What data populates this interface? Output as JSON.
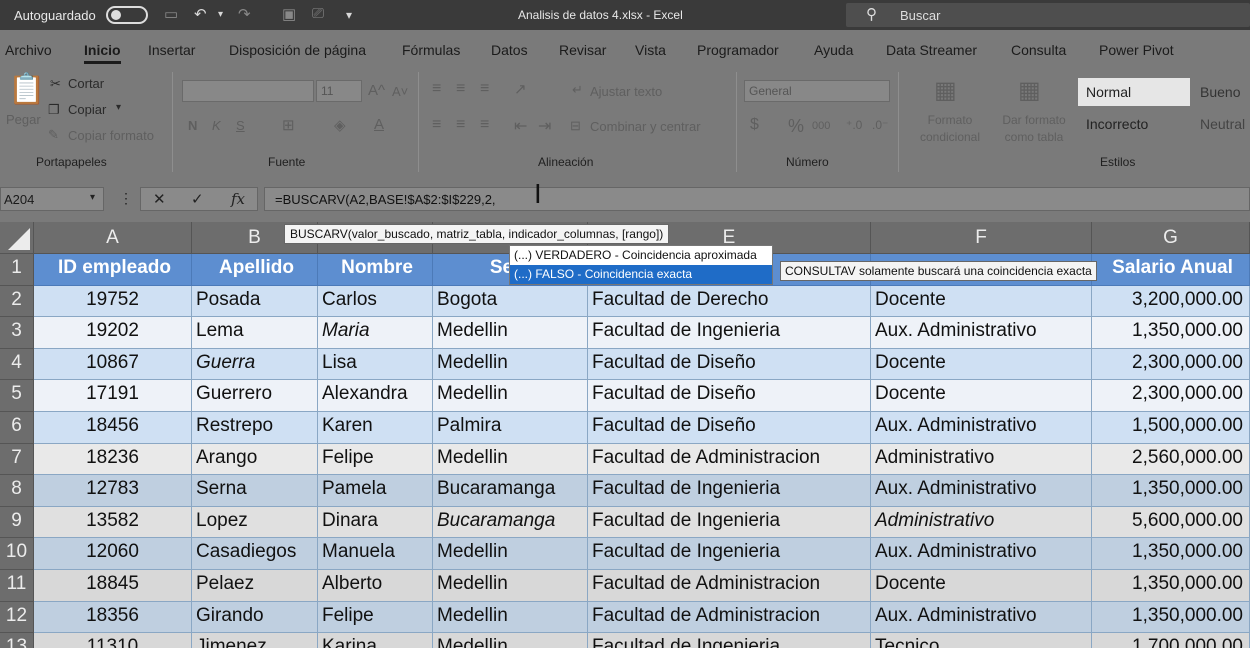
{
  "titlebar": {
    "autosave_label": "Autoguardado",
    "document_title": "Analisis de datos 4.xlsx  -  Excel",
    "search_placeholder": "Buscar"
  },
  "ribbon_tabs": [
    "Archivo",
    "Inicio",
    "Insertar",
    "Disposición de página",
    "Fórmulas",
    "Datos",
    "Revisar",
    "Vista",
    "Programador",
    "Ayuda",
    "Data Streamer",
    "Consulta",
    "Power Pivot"
  ],
  "active_tab": "Inicio",
  "ribbon": {
    "clipboard": {
      "paste": "Pegar",
      "cut": "Cortar",
      "copy": "Copiar",
      "copy_format": "Copiar formato",
      "label": "Portapapeles"
    },
    "font": {
      "size": "11",
      "bold": "N",
      "italic": "K",
      "underline": "S",
      "label": "Fuente"
    },
    "alignment": {
      "wrap": "Ajustar texto",
      "merge": "Combinar y centrar",
      "label": "Alineación"
    },
    "number": {
      "format": "General",
      "currency": "$",
      "percent": "%",
      "thousands": "000",
      "label": "Número"
    },
    "styles": {
      "conditional": "Formato condicional",
      "as_table": "Dar formato como tabla",
      "normal": "Normal",
      "bueno": "Bueno",
      "incorrecto": "Incorrecto",
      "neutral": "Neutral",
      "label": "Estilos"
    }
  },
  "formula_bar": {
    "name_box": "A204",
    "formula": "=BUSCARV(A2,BASE!$A$2:$I$229,2,"
  },
  "tooltip": {
    "syntax": "BUSCARV(valor_buscado, matriz_tabla, indicador_columnas, [rango])",
    "options": [
      "VERDADERO - Coincidencia aproximada",
      "FALSO - Coincidencia exacta"
    ],
    "option_prefix": "(...)",
    "note": "CONSULTAV solamente buscará una coincidencia exacta"
  },
  "sheet": {
    "columns": [
      "A",
      "B",
      "C",
      "D",
      "E",
      "F",
      "G"
    ],
    "row_numbers": [
      "1",
      "2",
      "3",
      "4",
      "5",
      "6",
      "7",
      "8",
      "9",
      "10",
      "11",
      "12",
      "13"
    ],
    "headers": [
      "ID empleado",
      "Apellido",
      "Nombre",
      "Secc",
      "",
      "",
      "Salario Anual"
    ],
    "rows": [
      [
        "19752",
        "Posada",
        "Carlos",
        "Bogota",
        "Facultad de Derecho",
        "Docente",
        "3,200,000.00"
      ],
      [
        "19202",
        "Lema",
        "Maria",
        "Medellin",
        "Facultad de Ingenieria",
        "Aux. Administrativo",
        "1,350,000.00"
      ],
      [
        "10867",
        "Guerra",
        "Lisa",
        "Medellin",
        "Facultad de Diseño",
        "Docente",
        "2,300,000.00"
      ],
      [
        "17191",
        "Guerrero",
        "Alexandra",
        "Medellin",
        "Facultad de Diseño",
        "Docente",
        "2,300,000.00"
      ],
      [
        "18456",
        "Restrepo",
        "Karen",
        "Palmira",
        "Facultad de Diseño",
        "Aux. Administrativo",
        "1,500,000.00"
      ],
      [
        "18236",
        "Arango",
        "Felipe",
        "Medellin",
        "Facultad de Administracion",
        "Administrativo",
        "2,560,000.00"
      ],
      [
        "12783",
        "Serna",
        "Pamela",
        "Bucaramanga",
        "Facultad de Ingenieria",
        "Aux. Administrativo",
        "1,350,000.00"
      ],
      [
        "13582",
        "Lopez",
        "Dinara",
        "Bucaramanga",
        "Facultad de Ingenieria",
        "Administrativo",
        "5,600,000.00"
      ],
      [
        "12060",
        "Casadiegos",
        "Manuela",
        "Medellin",
        "Facultad de Ingenieria",
        "Aux. Administrativo",
        "1,350,000.00"
      ],
      [
        "18845",
        "Pelaez",
        "Alberto",
        "Medellin",
        "Facultad de Administracion",
        "Docente",
        "1,350,000.00"
      ],
      [
        "18356",
        "Girando",
        "Felipe",
        "Medellin",
        "Facultad de Administracion",
        "Aux. Administrativo",
        "1,350,000.00"
      ],
      [
        "11310",
        "Jimenez",
        "Karina",
        "Medellin",
        "Facultad de Ingenieria",
        "Tecnico",
        "1,700,000.00"
      ]
    ],
    "italic_cells": [
      [
        1,
        2
      ],
      [
        2,
        1
      ],
      [
        7,
        3
      ],
      [
        7,
        5
      ]
    ],
    "row_colors": [
      "#cfe0f3",
      "#eef2f8",
      "#cfe0f3",
      "#eef2f8",
      "#cfe0f3",
      "#e9e9e9",
      "#bfcfe0",
      "#e0e0e0",
      "#bfcfe0",
      "#d8d8d8",
      "#bfcfe0",
      "#d8d8d8"
    ]
  }
}
